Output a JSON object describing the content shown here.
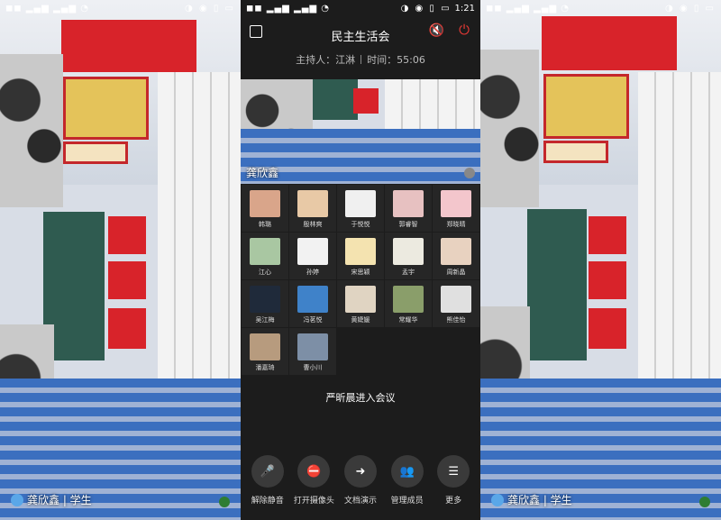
{
  "left_screen": {
    "status": {
      "signal": "◼◼ ▂▄▆ ▂▄▆ ◔",
      "icons": "◑ ◉ ▯ ▭"
    },
    "user_label": "龚欣鑫 | 学生"
  },
  "meeting": {
    "status": {
      "signal": "◼◼ ▂▄▆ ▂▄▆ ◔",
      "icons": "◑ ◉ ▯ ▭",
      "time": "1:21"
    },
    "title": "民主生活会",
    "host_label": "主持人：江淋",
    "time_label": "时间：55:06",
    "active_speaker": "龚欣鑫",
    "participants": [
      {
        "name": "韩璐",
        "color": "#d9a58a"
      },
      {
        "name": "殷林爽",
        "color": "#e8c9a6"
      },
      {
        "name": "于悦悦",
        "color": "#f0f0f0"
      },
      {
        "name": "郭睿智",
        "color": "#e7c1c1"
      },
      {
        "name": "郑晓晴",
        "color": "#f3c6cc"
      },
      {
        "name": "江心",
        "color": "#a9c7a2"
      },
      {
        "name": "孙婷",
        "color": "#f2f2f2"
      },
      {
        "name": "宋思颖",
        "color": "#f4e3b0"
      },
      {
        "name": "孟宇",
        "color": "#eceae0"
      },
      {
        "name": "周新晶",
        "color": "#e8d2c0"
      },
      {
        "name": "吴江梅",
        "color": "#1f2a3a"
      },
      {
        "name": "冯茗悦",
        "color": "#3f82c9"
      },
      {
        "name": "黄婕媛",
        "color": "#e0d4c2"
      },
      {
        "name": "常耀华",
        "color": "#8a9e6a"
      },
      {
        "name": "熊佳怡",
        "color": "#e0e0e0"
      },
      {
        "name": "潘嘉琦",
        "color": "#b79b7e"
      },
      {
        "name": "曹小川",
        "color": "#7d8fa6"
      }
    ],
    "notice": "严昕晨进入会议",
    "toolbar": [
      {
        "label": "解除静音",
        "icon": "mic-muted-icon",
        "glyph": "🎤",
        "red": true
      },
      {
        "label": "打开摄像头",
        "icon": "camera-off-icon",
        "glyph": "⛔",
        "red": true
      },
      {
        "label": "文档演示",
        "icon": "document-share-icon",
        "glyph": "➜",
        "red": false
      },
      {
        "label": "管理成员",
        "icon": "members-icon",
        "glyph": "👥",
        "red": false
      },
      {
        "label": "更多",
        "icon": "more-menu-icon",
        "glyph": "☰",
        "red": false
      }
    ]
  },
  "right_screen": {
    "status": {
      "signal": "◼◼ ▂▄▆ ▂▄▆ ◔",
      "icons": "◑ ◉ ▯ ▭"
    },
    "user_label": "龚欣鑫 | 学生"
  },
  "colors": {
    "accent_red": "#e53935",
    "dark_bg": "#1c1c1c",
    "mic_green": "#2e7d32"
  }
}
